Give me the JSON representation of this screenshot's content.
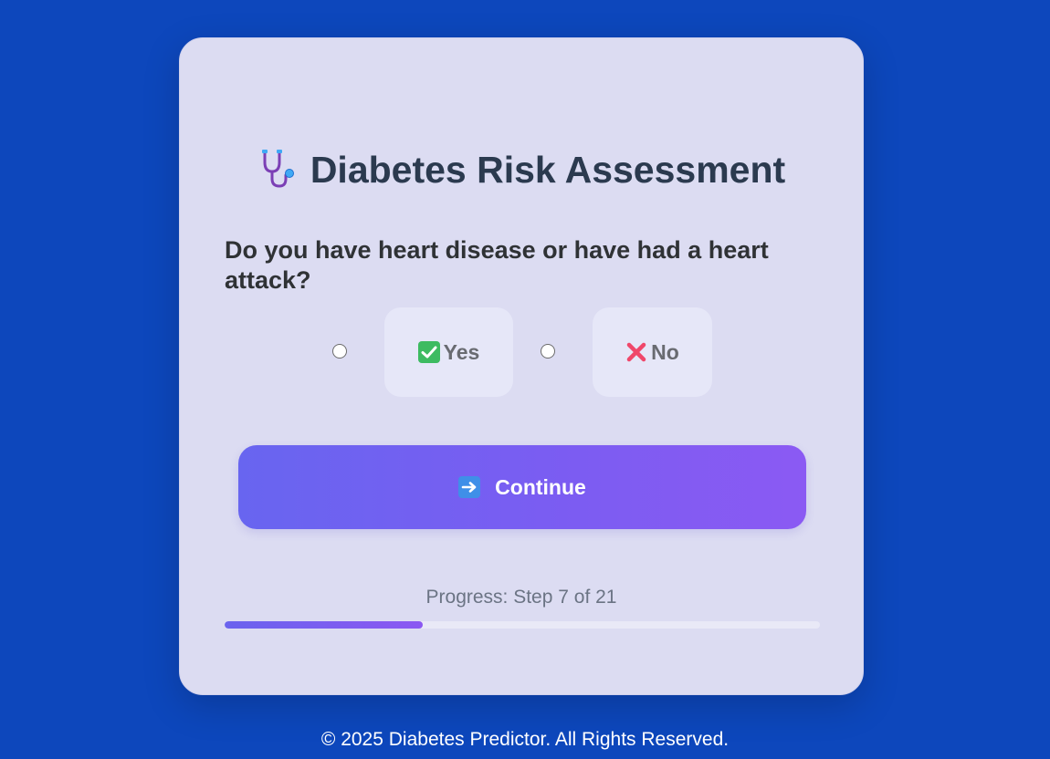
{
  "header": {
    "icon": "stethoscope-icon",
    "title": "Diabetes Risk Assessment"
  },
  "question": {
    "text": "Do you have heart disease or have had a heart attack?"
  },
  "options": [
    {
      "label": "Yes",
      "icon": "check-mark-icon",
      "selected": false
    },
    {
      "label": "No",
      "icon": "cross-mark-icon",
      "selected": false
    }
  ],
  "actions": {
    "continue_label": "Continue",
    "continue_icon": "right-arrow-icon"
  },
  "progress": {
    "label": "Progress: Step 7 of 21",
    "current_step": 7,
    "total_steps": 21,
    "fraction": 0.333
  },
  "footer": {
    "text": "© 2025 Diabetes Predictor. All Rights Reserved."
  },
  "colors": {
    "background": "#0d47bc",
    "card": "#dcdcf2",
    "accent_start": "#6865f0",
    "accent_end": "#8b5af3",
    "title_text": "#2b3a4f"
  }
}
